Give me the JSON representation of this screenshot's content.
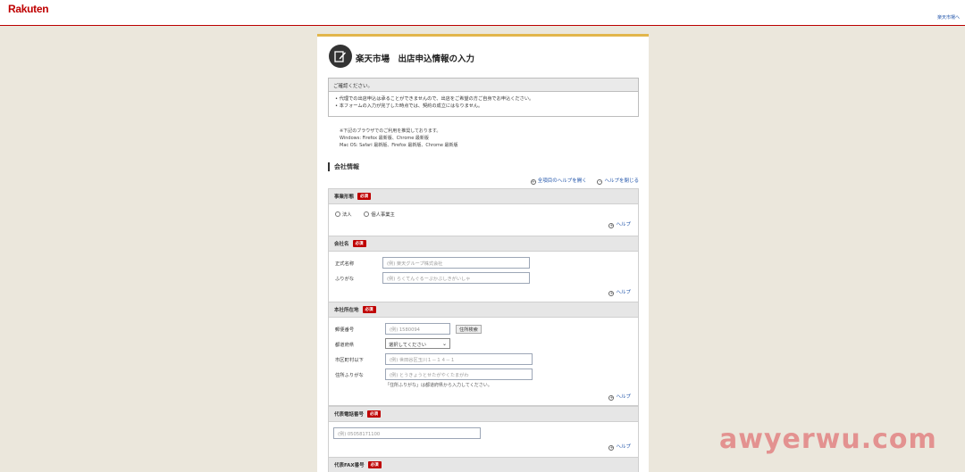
{
  "header": {
    "logo": "Rakuten",
    "top_link": "楽天市場へ"
  },
  "page": {
    "title": "楽天市場　出店申込情報の入力"
  },
  "notice": {
    "heading": "ご確認ください。",
    "items": [
      "代理での出店申込は承ることができませんので、出店をご希望の方ご自身でお申込ください。",
      "本フォームの入力が完了した時点では、契約の成立にはなりません。"
    ]
  },
  "browser_info": {
    "line1": "※下記のブラウザでのご利用を推奨しております。",
    "line2": "Windows: Firefox 最新版、Chrome 最新版",
    "line3": "Mac OS: Safari 最新版、Firefox 最新版、Chrome 最新版"
  },
  "section": {
    "title": "会社情報",
    "open_all_help": "全項目のヘルプを開く",
    "close_help": "ヘルプを閉じる"
  },
  "required_label": "必須",
  "help_label": "ヘルプ",
  "business_type": {
    "label": "事業形態",
    "options": [
      "法人",
      "個人事業主"
    ]
  },
  "company_name": {
    "label": "会社名",
    "official_label": "正式名称",
    "official_placeholder": "(例) 楽天グループ株式会社",
    "kana_label": "ふりがな",
    "kana_placeholder": "(例) らくてんぐるーぷかぶしきがいしゃ"
  },
  "address": {
    "label": "本社所在地",
    "postal_label": "郵便番号",
    "postal_placeholder": "(例) 1580094",
    "search_button": "住所検索",
    "pref_label": "都道府県",
    "pref_value": "選択してください",
    "city_label": "市区町村以下",
    "city_placeholder": "(例) 世田谷区玉川１－１４－１",
    "kana_label": "住所ふりがな",
    "kana_placeholder": "(例) とうきょうとせたがやくたまがわ",
    "kana_note": "「住所ふりがな」は都道府県から入力してください。"
  },
  "phone": {
    "label": "代表電話番号",
    "placeholder": "(例) 05058171100"
  },
  "fax": {
    "label": "代表FAX番号"
  },
  "watermark": "awyerwu.com"
}
